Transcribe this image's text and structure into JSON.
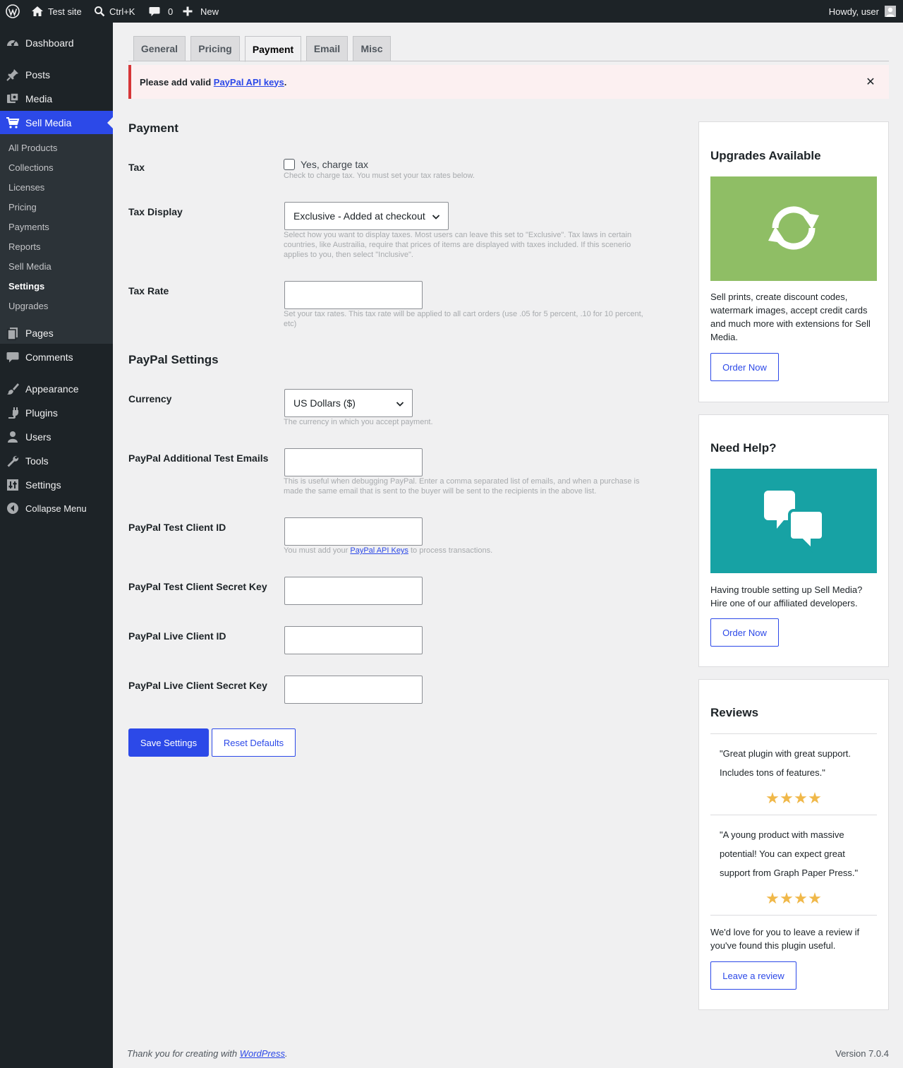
{
  "adminbar": {
    "site_name": "Test site",
    "search_shortcut": "Ctrl+K",
    "comments_count": "0",
    "new_label": "New",
    "greeting": "Howdy, user"
  },
  "sidebar": {
    "dashboard": "Dashboard",
    "posts": "Posts",
    "media": "Media",
    "sell_media": "Sell Media",
    "submenu": [
      "All Products",
      "Collections",
      "Licenses",
      "Pricing",
      "Payments",
      "Reports",
      "Sell Media",
      "Settings",
      "Upgrades"
    ],
    "pages": "Pages",
    "comments": "Comments",
    "appearance": "Appearance",
    "plugins": "Plugins",
    "users": "Users",
    "tools": "Tools",
    "settings": "Settings",
    "collapse": "Collapse Menu"
  },
  "tabs": [
    "General",
    "Pricing",
    "Payment",
    "Email",
    "Misc"
  ],
  "notice": {
    "prefix": "Please add valid ",
    "link": "PayPal API keys",
    "suffix": "."
  },
  "payment": {
    "title": "Payment",
    "tax_label": "Tax",
    "tax_checkbox": "Yes, charge tax",
    "tax_desc": "Check to charge tax. You must set your tax rates below.",
    "tax_display_label": "Tax Display",
    "tax_display_value": "Exclusive - Added at checkout",
    "tax_display_desc": "Select how you want to display taxes. Most users can leave this set to \"Exclusive\". Tax laws in certain countries, like Austrailia, require that prices of items are displayed with taxes included. If this scenerio applies to you, then select \"Inclusive\".",
    "tax_rate_label": "Tax Rate",
    "tax_rate_value": "",
    "tax_rate_desc": "Set your tax rates. This tax rate will be applied to all cart orders (use .05 for 5 percent, .10 for 10 percent, etc)"
  },
  "paypal": {
    "title": "PayPal Settings",
    "currency_label": "Currency",
    "currency_value": "US Dollars ($)",
    "currency_desc": "The currency in which you accept payment.",
    "test_emails_label": "PayPal Additional Test Emails",
    "test_emails_desc": "This is useful when debugging PayPal. Enter a comma separated list of emails, and when a purchase is made the same email that is sent to the buyer will be sent to the recipients in the above list.",
    "test_client_id_label": "PayPal Test Client ID",
    "test_client_id_desc_prefix": "You must add your ",
    "test_client_id_desc_link": "PayPal API Keys",
    "test_client_id_desc_suffix": " to process transactions.",
    "test_secret_label": "PayPal Test Client Secret Key",
    "live_client_id_label": "PayPal Live Client ID",
    "live_secret_label": "PayPal Live Client Secret Key"
  },
  "buttons": {
    "save": "Save Settings",
    "reset": "Reset Defaults"
  },
  "panels": {
    "upgrades": {
      "title": "Upgrades Available",
      "text": "Sell prints, create discount codes, watermark images, accept credit cards and much more with extensions for Sell Media.",
      "button": "Order Now",
      "image_color": "#8fbe65",
      "icon": "refresh-icon"
    },
    "help": {
      "title": "Need Help?",
      "text": "Having trouble setting up Sell Media? Hire one of our affiliated developers.",
      "button": "Order Now",
      "image_color": "#17a2a4",
      "icon": "chat-bubbles-icon"
    },
    "reviews": {
      "title": "Reviews",
      "items": [
        {
          "text": "\"Great plugin with great support. Includes tons of features.\"",
          "rating": 4
        },
        {
          "text": "\"A young product with massive potential! You can expect great support from Graph Paper Press.\"",
          "rating": 4
        }
      ],
      "outro": "We'd love for you to leave a review if you've found this plugin useful.",
      "button": "Leave a review"
    }
  },
  "footer": {
    "thanks_prefix": "Thank you for creating with ",
    "thanks_link": "WordPress",
    "thanks_suffix": ".",
    "version": "Version 7.0.4"
  },
  "colors": {
    "accent": "#2c49e8",
    "adminbar_bg": "#1d2327",
    "notice_border": "#d63638",
    "star": "#f0b849"
  }
}
